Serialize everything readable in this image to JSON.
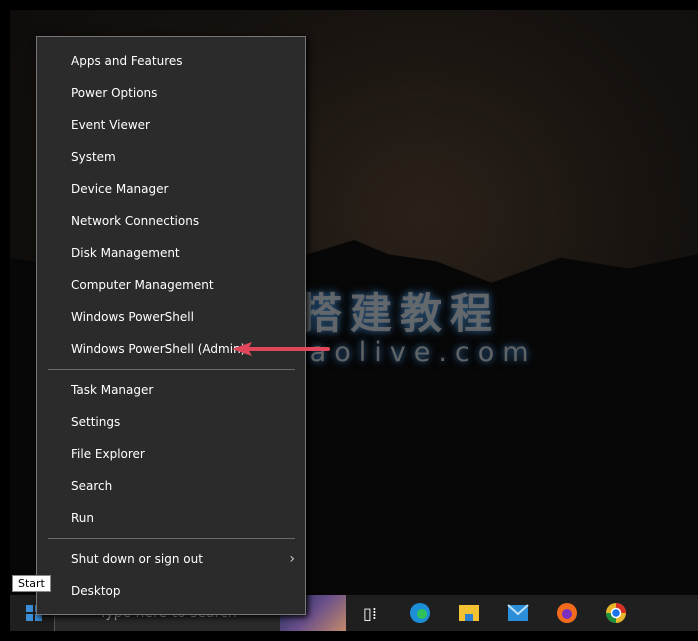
{
  "menu": {
    "items": [
      "Apps and Features",
      "Power Options",
      "Event Viewer",
      "System",
      "Device Manager",
      "Network Connections",
      "Disk Management",
      "Computer Management",
      "Windows PowerShell",
      "Windows PowerShell (Admin)",
      "Task Manager",
      "Settings",
      "File Explorer",
      "Search",
      "Run",
      "Shut down or sign out",
      "Desktop"
    ]
  },
  "tooltip": "Start",
  "taskbar": {
    "search_placeholder": "Type here to search",
    "apps": [
      "task-view-icon",
      "edge-icon",
      "file-explorer-icon",
      "mail-icon",
      "firefox-icon",
      "chrome-canary-icon"
    ]
  },
  "watermark": {
    "line1": "老吴搭建教程",
    "line2": "weixiaolive.com"
  },
  "colors": {
    "menu_bg": "#2b2b2b",
    "taskbar": "#1f1f1f",
    "arrow": "#e0475a",
    "accent": "#3a8fd8"
  }
}
